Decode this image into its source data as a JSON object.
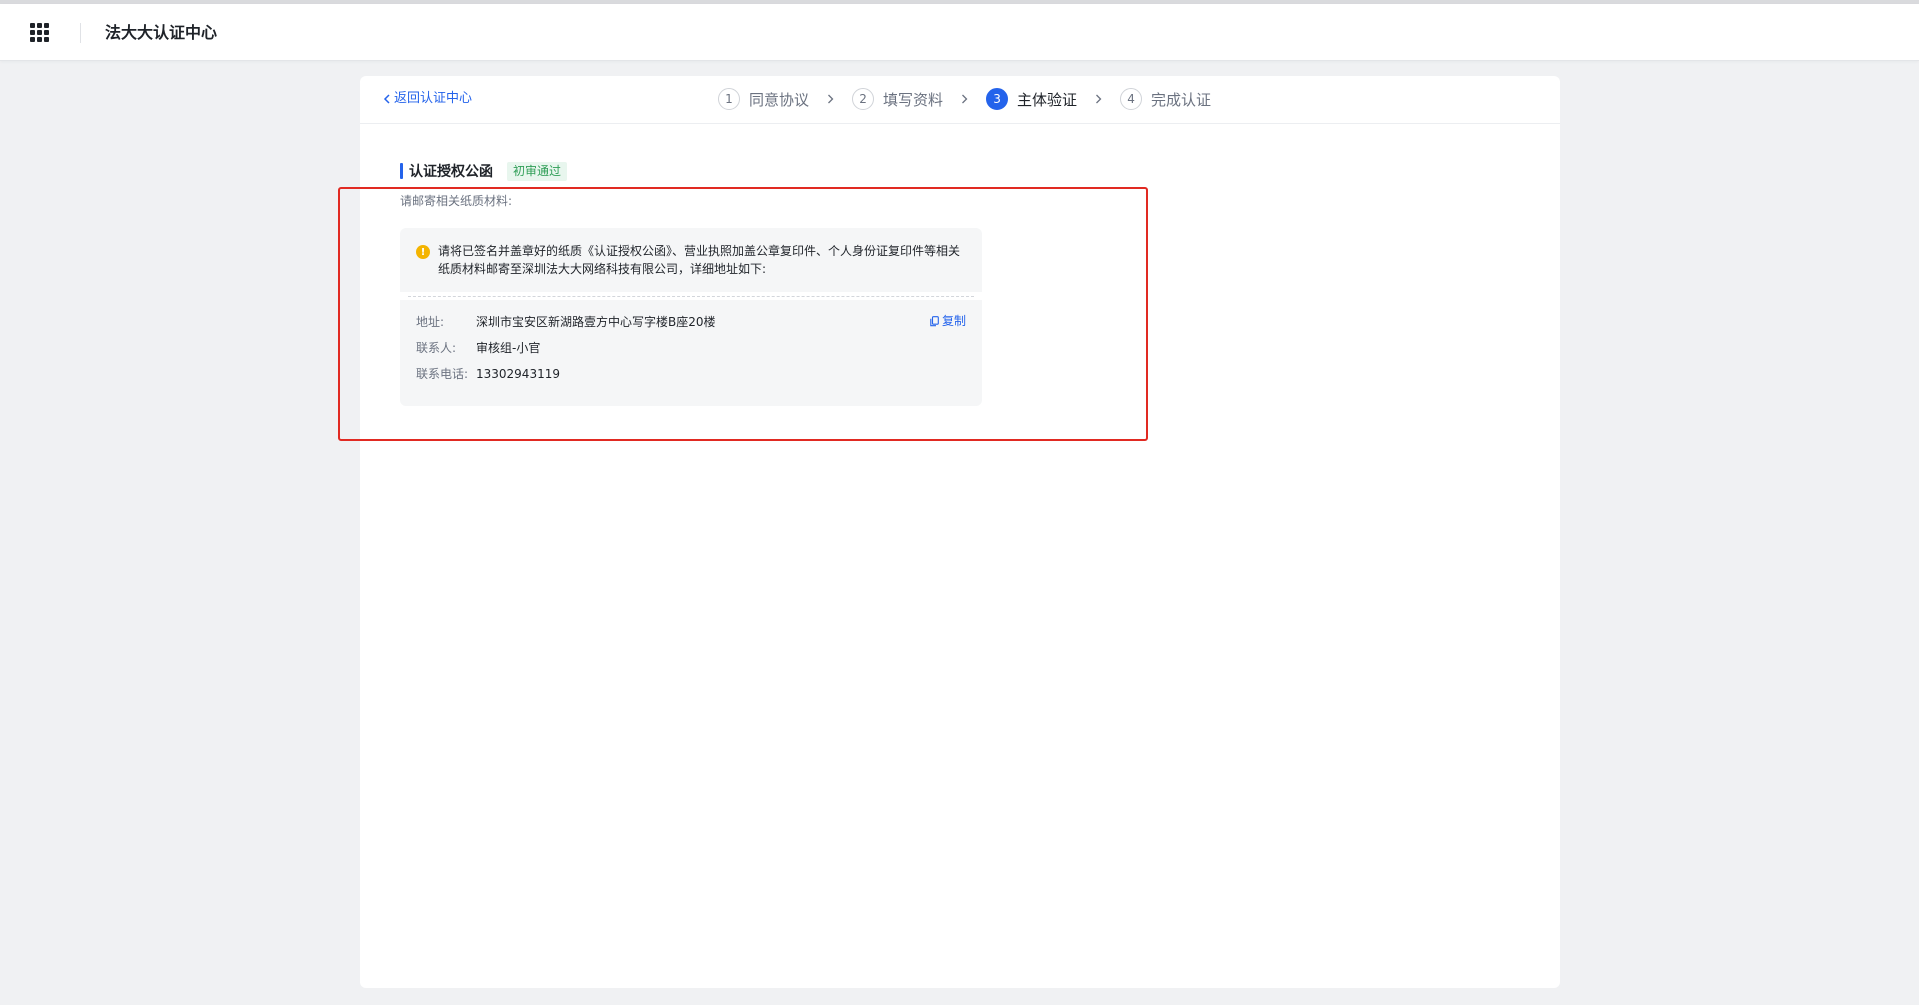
{
  "header": {
    "app_title": "法大大认证中心",
    "menu_icon": "apps-grid-icon"
  },
  "nav": {
    "back_label": "返回认证中心",
    "steps": [
      {
        "num": "1",
        "label": "同意协议",
        "state": "done"
      },
      {
        "num": "2",
        "label": "填写资料",
        "state": "done"
      },
      {
        "num": "3",
        "label": "主体验证",
        "state": "active"
      },
      {
        "num": "4",
        "label": "完成认证",
        "state": "pending"
      }
    ]
  },
  "section": {
    "title": "认证授权公函",
    "status_badge": "初审通过",
    "hint": "请邮寄相关纸质材料:"
  },
  "notice": {
    "icon": "warning-icon",
    "text": "请将已签名并盖章好的纸质《认证授权公函》、营业执照加盖公章复印件、个人身份证复印件等相关纸质材料邮寄至深圳法大大网络科技有限公司，详细地址如下:"
  },
  "mailing": {
    "address_label": "地址:",
    "address_value": "深圳市宝安区新湖路壹方中心写字楼B座20楼",
    "contact_label": "联系人:",
    "contact_value": "审核组-小官",
    "phone_label": "联系电话:",
    "phone_value": "13302943119",
    "copy_label": "复制"
  },
  "colors": {
    "accent": "#2463eb",
    "success": "#2f9e57",
    "warning": "#f4b400",
    "highlight_border": "#e12a22"
  }
}
